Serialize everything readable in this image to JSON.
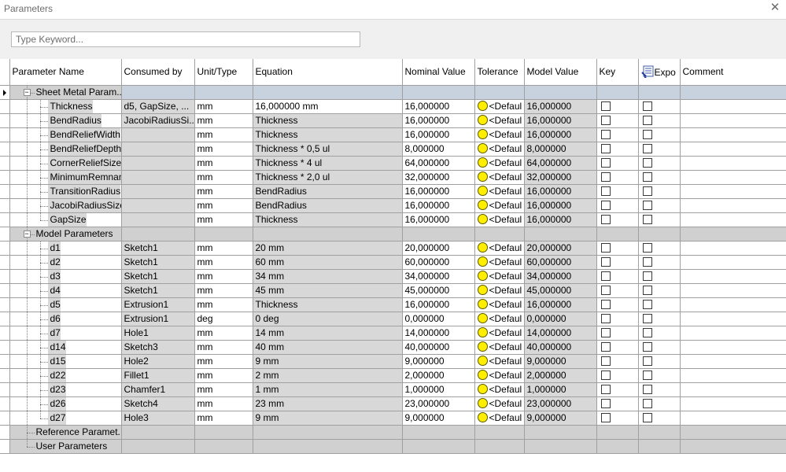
{
  "window": {
    "title": "Parameters"
  },
  "search": {
    "placeholder": "Type Keyword..."
  },
  "columns": {
    "name": "Parameter Name",
    "consumed": "Consumed by",
    "unit": "Unit/Type",
    "equation": "Equation",
    "nominal": "Nominal Value",
    "tolerance": "Tolerance",
    "model": "Model Value",
    "key": "Key",
    "export": "Expo",
    "comment": "Comment"
  },
  "groups": {
    "sheet_metal": "Sheet Metal Param...",
    "model": "Model Parameters",
    "reference": "Reference Paramet...",
    "user": "User Parameters"
  },
  "sheet_metal_rows": [
    {
      "name": "Thickness",
      "consumed": "d5, GapSize, ...",
      "unit": "mm",
      "equation": "16,000000 mm",
      "nominal": "16,000000",
      "tolerance": "<Defaul",
      "model": "16,000000"
    },
    {
      "name": "BendRadius",
      "consumed": "JacobiRadiusSi...",
      "unit": "mm",
      "equation": "Thickness",
      "nominal": "16,000000",
      "tolerance": "<Defaul",
      "model": "16,000000"
    },
    {
      "name": "BendReliefWidth",
      "consumed": "",
      "unit": "mm",
      "equation": "Thickness",
      "nominal": "16,000000",
      "tolerance": "<Defaul",
      "model": "16,000000"
    },
    {
      "name": "BendReliefDepth",
      "consumed": "",
      "unit": "mm",
      "equation": "Thickness * 0,5 ul",
      "nominal": "8,000000",
      "tolerance": "<Defaul",
      "model": "8,000000"
    },
    {
      "name": "CornerReliefSize",
      "consumed": "",
      "unit": "mm",
      "equation": "Thickness * 4 ul",
      "nominal": "64,000000",
      "tolerance": "<Defaul",
      "model": "64,000000"
    },
    {
      "name": "MinimumRemnant",
      "consumed": "",
      "unit": "mm",
      "equation": "Thickness * 2,0 ul",
      "nominal": "32,000000",
      "tolerance": "<Defaul",
      "model": "32,000000"
    },
    {
      "name": "TransitionRadius",
      "consumed": "",
      "unit": "mm",
      "equation": "BendRadius",
      "nominal": "16,000000",
      "tolerance": "<Defaul",
      "model": "16,000000"
    },
    {
      "name": "JacobiRadiusSize",
      "consumed": "",
      "unit": "mm",
      "equation": "BendRadius",
      "nominal": "16,000000",
      "tolerance": "<Defaul",
      "model": "16,000000"
    },
    {
      "name": "GapSize",
      "consumed": "",
      "unit": "mm",
      "equation": "Thickness",
      "nominal": "16,000000",
      "tolerance": "<Defaul",
      "model": "16,000000"
    }
  ],
  "model_rows": [
    {
      "name": "d1",
      "consumed": "Sketch1",
      "unit": "mm",
      "equation": "20 mm",
      "nominal": "20,000000",
      "tolerance": "<Defaul",
      "model": "20,000000"
    },
    {
      "name": "d2",
      "consumed": "Sketch1",
      "unit": "mm",
      "equation": "60 mm",
      "nominal": "60,000000",
      "tolerance": "<Defaul",
      "model": "60,000000"
    },
    {
      "name": "d3",
      "consumed": "Sketch1",
      "unit": "mm",
      "equation": "34 mm",
      "nominal": "34,000000",
      "tolerance": "<Defaul",
      "model": "34,000000"
    },
    {
      "name": "d4",
      "consumed": "Sketch1",
      "unit": "mm",
      "equation": "45 mm",
      "nominal": "45,000000",
      "tolerance": "<Defaul",
      "model": "45,000000"
    },
    {
      "name": "d5",
      "consumed": "Extrusion1",
      "unit": "mm",
      "equation": "Thickness",
      "nominal": "16,000000",
      "tolerance": "<Defaul",
      "model": "16,000000"
    },
    {
      "name": "d6",
      "consumed": "Extrusion1",
      "unit": "deg",
      "equation": "0 deg",
      "nominal": "0,000000",
      "tolerance": "<Defaul",
      "model": "0,000000"
    },
    {
      "name": "d7",
      "consumed": "Hole1",
      "unit": "mm",
      "equation": "14 mm",
      "nominal": "14,000000",
      "tolerance": "<Defaul",
      "model": "14,000000"
    },
    {
      "name": "d14",
      "consumed": "Sketch3",
      "unit": "mm",
      "equation": "40 mm",
      "nominal": "40,000000",
      "tolerance": "<Defaul",
      "model": "40,000000"
    },
    {
      "name": "d15",
      "consumed": "Hole2",
      "unit": "mm",
      "equation": "9 mm",
      "nominal": "9,000000",
      "tolerance": "<Defaul",
      "model": "9,000000"
    },
    {
      "name": "d22",
      "consumed": "Fillet1",
      "unit": "mm",
      "equation": "2 mm",
      "nominal": "2,000000",
      "tolerance": "<Defaul",
      "model": "2,000000"
    },
    {
      "name": "d23",
      "consumed": "Chamfer1",
      "unit": "mm",
      "equation": "1 mm",
      "nominal": "1,000000",
      "tolerance": "<Defaul",
      "model": "1,000000"
    },
    {
      "name": "d26",
      "consumed": "Sketch4",
      "unit": "mm",
      "equation": "23 mm",
      "nominal": "23,000000",
      "tolerance": "<Defaul",
      "model": "23,000000"
    },
    {
      "name": "d27",
      "consumed": "Hole3",
      "unit": "mm",
      "equation": "9 mm",
      "nominal": "9,000000",
      "tolerance": "<Defaul",
      "model": "9,000000"
    }
  ],
  "colors": {
    "tolerance_dot": "#ffee00",
    "cell_shade": "#d8d8d8",
    "group_row": "#d0d0d0",
    "selected_group": "#c7d2de"
  },
  "icons": {
    "close": "close-icon",
    "export_header": "export-parameter-icon",
    "tolerance": "tolerance-circle-icon",
    "row_pointer": "row-pointer-icon"
  }
}
